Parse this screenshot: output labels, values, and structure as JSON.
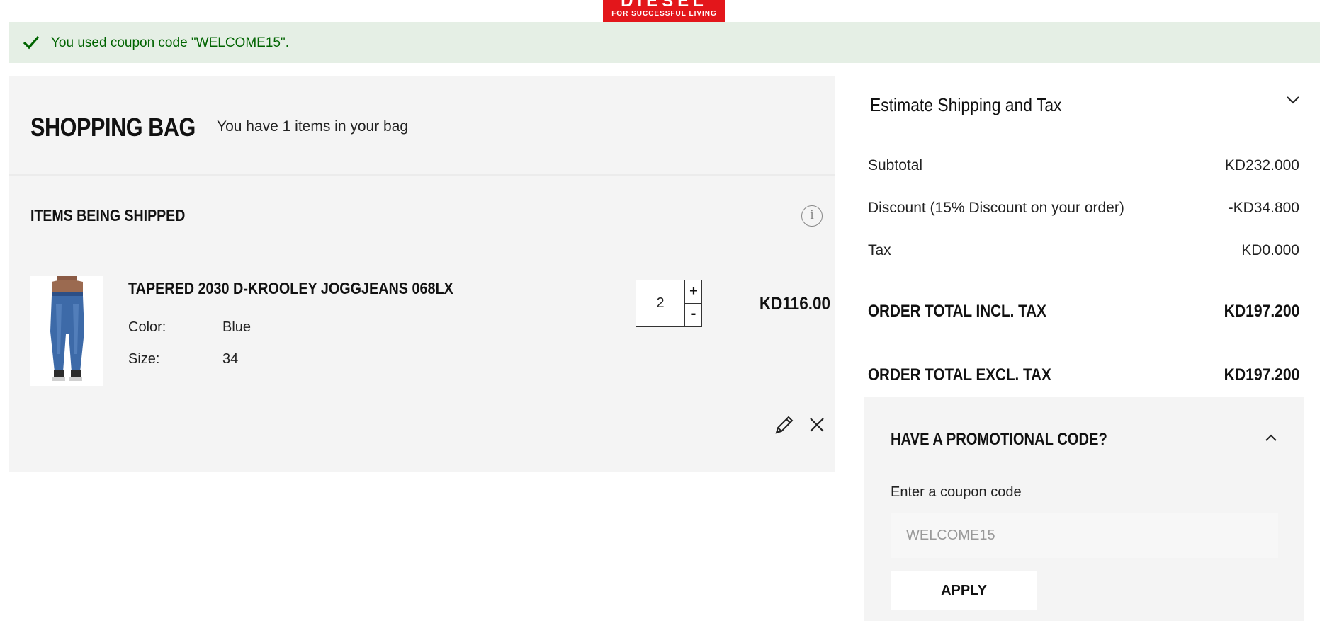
{
  "brand": {
    "logo_text": "DIESEL",
    "tagline": "FOR SUCCESSFUL LIVING",
    "color": "#e3161b"
  },
  "message": {
    "icon": "checkmark-icon",
    "text": "You used coupon code \"WELCOME15\".",
    "color": "#006400"
  },
  "cart": {
    "title": "SHOPPING BAG",
    "subtitle": "You have 1 items in your bag",
    "section_title": "ITEMS BEING SHIPPED",
    "info_icon_glyph": "i",
    "items": [
      {
        "name": "TAPERED 2030 D-KROOLEY JOGGJEANS 068LX",
        "options": [
          {
            "label": "Color:",
            "value": "Blue"
          },
          {
            "label": "Size:",
            "value": "34"
          }
        ],
        "quantity": "2",
        "plus_label": "+",
        "minus_label": "-",
        "price": "KD116.00",
        "edit_icon": "pencil-icon",
        "remove_icon": "close-icon"
      }
    ]
  },
  "summary": {
    "estimate_title": "Estimate Shipping and Tax",
    "rows": [
      {
        "label": "Subtotal",
        "value": "KD232.000"
      },
      {
        "label": "Discount (15% Discount on your order)",
        "value": "-KD34.800"
      },
      {
        "label": "Tax",
        "value": "KD0.000"
      }
    ],
    "totals": [
      {
        "label": "ORDER TOTAL INCL. TAX",
        "value": "KD197.200"
      },
      {
        "label": "ORDER TOTAL EXCL. TAX",
        "value": "KD197.200"
      }
    ]
  },
  "promo": {
    "title": "HAVE A PROMOTIONAL CODE?",
    "label": "Enter a coupon code",
    "input_value": "",
    "placeholder": "WELCOME15",
    "apply_label": "APPLY"
  }
}
